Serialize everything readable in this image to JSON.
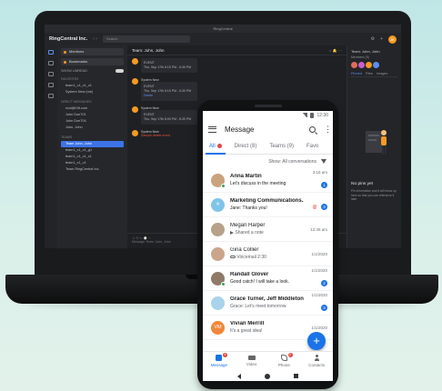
{
  "desktop": {
    "window_title": "RingCentral",
    "brand": "RingCentral Inc.",
    "search_placeholder": "Search",
    "user_initials": "JK",
    "sidebar": {
      "mentions": "Mentions",
      "bookmarks": "Bookmarks",
      "show_unreads": "SHOW UNREAD",
      "favorites_head": "FAVORITES",
      "favorites": [
        "team1_c1_c1_c1",
        "System New (me)"
      ],
      "dm_head": "DIRECT MESSAGES",
      "dms": [
        "root@Kitt.com",
        "John Doe701",
        "John Doe704",
        "John, John"
      ],
      "teams_head": "TEAMS",
      "teams": [
        "Team John, John",
        "team1_c1_c1_g1",
        "team1_c1_c1_c1",
        "team1_c1_c1",
        "Team RingCentral Inc."
      ]
    },
    "conversation": {
      "title": "Team: John, John",
      "meta_icons": "☆ 🔔 ⋯",
      "sender": "System New",
      "event_label": "EVENT",
      "event_date": "Thu, Sep 17th 6:15 PM - 6:30 PM",
      "event_date_2": "Thu, Sep 17th 8:00 PM - 8:30 PM",
      "hide_link": "Delete",
      "danger_text": "Sample delete event",
      "compose_placeholder": "Message Team: John, John"
    },
    "right_panel": {
      "title": "Team: John, John",
      "members": "Members (5)",
      "tabs": [
        "Pinned",
        "Files",
        "Images"
      ],
      "empty_title": "No pins yet",
      "empty_desc": "Pin information and it will show up here so that you can reference it later"
    }
  },
  "phone": {
    "time": "12:30",
    "title": "Message",
    "tabs": [
      "All",
      "Direct (8)",
      "Teams (9)",
      "Favo"
    ],
    "filter_label": "Show: All conversations",
    "conversations": [
      {
        "name": "Anna Martin",
        "preview": "Let's discuss in the meeting",
        "time": "3:15 am",
        "badge": "1",
        "avatar_color": "#c9a27e",
        "unread": true
      },
      {
        "name": "Marketing Communications...",
        "preview": "Jane: Thanks you!",
        "time": "",
        "badge": "3",
        "avatar_color": "#7fc4e8",
        "unread": true,
        "mention": "@"
      },
      {
        "name": "Megan Harper",
        "preview": "Shared a note",
        "time": "12:45 am",
        "badge": "",
        "avatar_color": "#b7a189",
        "unread": false
      },
      {
        "name": "Gina Collier",
        "preview": "Voicemail 2:30",
        "time": "1/1/2020",
        "badge": "",
        "avatar_color": "#caa58b",
        "unread": false
      },
      {
        "name": "Randall Glover",
        "preview": "Good catch! I will take a look.",
        "time": "1/1/2020",
        "badge": "2",
        "avatar_color": "#8f7a68",
        "unread": true
      },
      {
        "name": "Grace Turner, Jeff Middleton...",
        "preview": "Grace: Let's meet tomorrow.",
        "time": "1/1/2020",
        "badge": "3",
        "avatar_color": "#a9d3ea",
        "unread": true
      },
      {
        "name": "Vivian Merrill",
        "preview": "It's a great idea!",
        "time": "1/1/2020",
        "badge": "",
        "avatar_color": "#f0873a",
        "initials": "VM",
        "unread": false
      }
    ],
    "nav": [
      {
        "label": "Message",
        "badge": "4"
      },
      {
        "label": "Video",
        "badge": ""
      },
      {
        "label": "Phone",
        "badge": "2"
      },
      {
        "label": "Contacts",
        "badge": ""
      }
    ],
    "fab": "+",
    "colors": {
      "accent": "#1a73e8",
      "alert": "#e8453c",
      "presence": "#34a853"
    }
  }
}
